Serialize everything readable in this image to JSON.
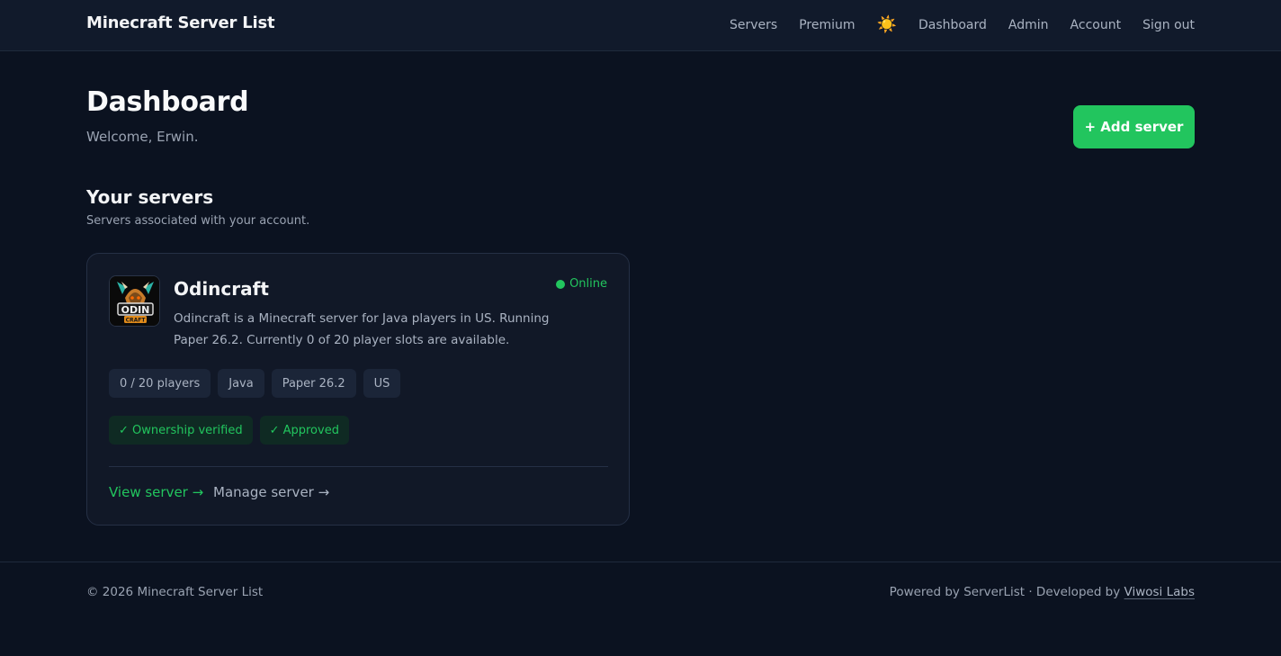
{
  "header": {
    "brand": "Minecraft Server List",
    "nav": {
      "servers": "Servers",
      "premium": "Premium",
      "theme_icon": "☀️",
      "dashboard": "Dashboard",
      "admin": "Admin",
      "account": "Account",
      "sign_out": "Sign out"
    }
  },
  "page": {
    "title": "Dashboard",
    "welcome": "Welcome, Erwin.",
    "add_server_label": "+ Add server"
  },
  "servers_section": {
    "title": "Your servers",
    "subtitle": "Servers associated with your account."
  },
  "server": {
    "name": "Odincraft",
    "logo_text_top": "ODIN",
    "logo_text_bottom": "CRAFT",
    "status": "Online",
    "description": "Odincraft is a Minecraft server for Java players in US. Running Paper 26.2. Currently 0 of 20 player slots are available.",
    "tags": [
      "0 / 20 players",
      "Java",
      "Paper 26.2",
      "US"
    ],
    "badges": [
      "✓ Ownership verified",
      "✓ Approved"
    ],
    "view_label": "View server →",
    "manage_label": "Manage server →"
  },
  "footer": {
    "copyright": "© 2026 Minecraft Server List",
    "powered_prefix": "Powered by ServerList · Developed by ",
    "developer": "Viwosi Labs"
  },
  "colors": {
    "background": "#0b1220",
    "accent": "#22c55e",
    "card": "#111827"
  },
  "icons": [
    "sun-icon",
    "status-dot-icon",
    "check-icon",
    "arrow-right-icon"
  ]
}
